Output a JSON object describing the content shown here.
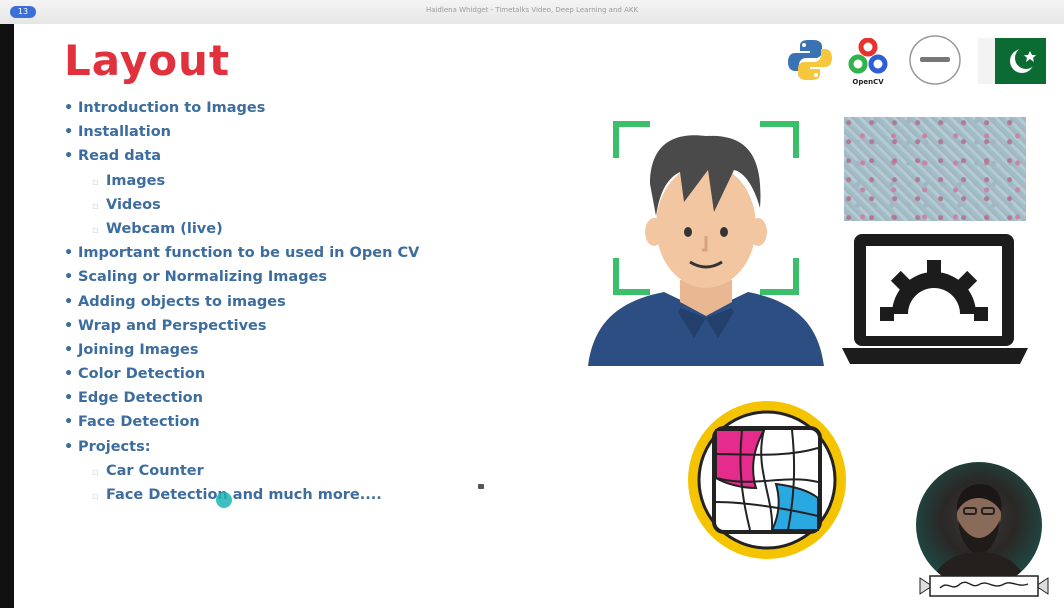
{
  "window": {
    "badge": "13",
    "title": "Haidlena Whidget - Timetalks Video, Deep Learning and AKK"
  },
  "slide": {
    "title": "Layout",
    "items": [
      {
        "text": "Introduction to Images",
        "level": 1
      },
      {
        "text": "Installation",
        "level": 1
      },
      {
        "text": "Read data",
        "level": 1
      },
      {
        "text": "Images",
        "level": 2
      },
      {
        "text": "Videos",
        "level": 2
      },
      {
        "text": "Webcam (live)",
        "level": 2
      },
      {
        "text": "Important function to be used in Open CV",
        "level": 1
      },
      {
        "text": "Scaling or Normalizing Images",
        "level": 1
      },
      {
        "text": "Adding objects to images",
        "level": 1
      },
      {
        "text": "Wrap and Perspectives",
        "level": 1
      },
      {
        "text": "Joining Images",
        "level": 1
      },
      {
        "text": "Color Detection",
        "level": 1
      },
      {
        "text": "Edge Detection",
        "level": 1
      },
      {
        "text": "Face Detection",
        "level": 1
      },
      {
        "text": "Projects:",
        "level": 1
      },
      {
        "text": "Car Counter",
        "level": 2
      },
      {
        "text": "Face Detection and much more....",
        "level": 2
      }
    ],
    "logos": {
      "python": "python-logo-icon",
      "opencv": "opencv-logo-icon",
      "opencv_label": "OpenCV",
      "circle_logo": "circle-logo-icon",
      "flag": "pakistan-flag-icon"
    },
    "colors": {
      "title": "#e0313c",
      "text": "#3c6d9e",
      "frame": "#3bbf6a",
      "shirt": "#2d4e82",
      "hair": "#4a4a4a",
      "skin": "#f2c6a0"
    }
  }
}
